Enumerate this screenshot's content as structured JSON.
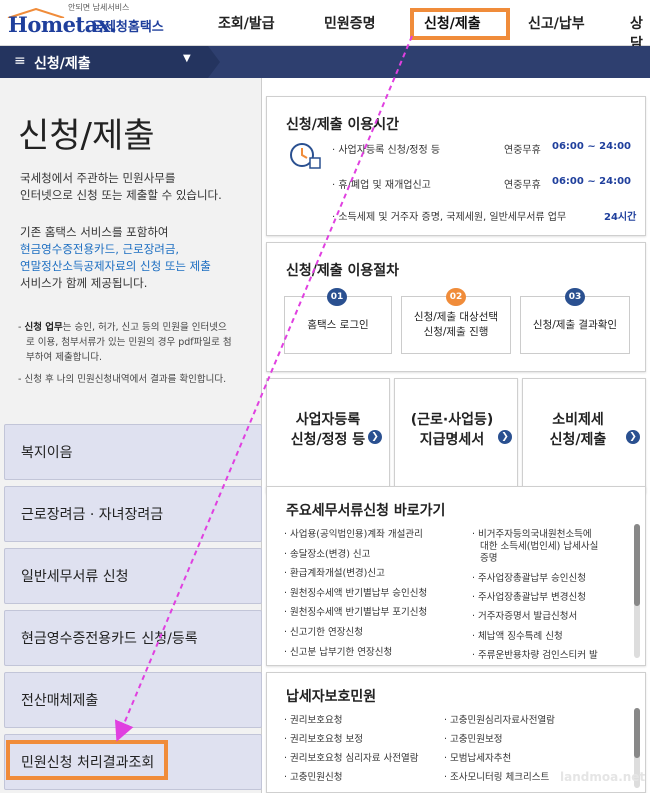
{
  "logo": {
    "slogan": "안되면 남세서비스",
    "main": "Hometax.",
    "sub": "국세청홈택스"
  },
  "nav": {
    "items": [
      "조회/발급",
      "민원증명",
      "신청/제출",
      "신고/납부",
      "상담"
    ]
  },
  "band": {
    "title": "신청/제출"
  },
  "left": {
    "title": "신청/제출",
    "desc1": [
      "국세청에서 주관하는 민원사무를",
      "인터넷으로 신청 또는 제출할 수 있습니다."
    ],
    "desc2_plain": "기존 홈택스 서비스를 포함하여",
    "desc2_links": [
      "현금영수증전용카드, 근로장려금,",
      "연말정산소득공제자료의 신청 또는 제출"
    ],
    "desc2_tail": "서비스가 함께 제공됩니다.",
    "note1_bold": "신청 업무",
    "note1": "는 승인, 허가, 신고 등의 민원을 인터넷으",
    "note1b": "로 이용, 첨부서류가 있는 민원의 경우 pdf파일로 첨",
    "note1c": "부하여 제출합니다.",
    "note2": "신청 후 나의 민원신청내역에서 결과를 확인합니다.",
    "menu": [
      "복지이음",
      "근로장려금 · 자녀장려금",
      "일반세무서류 신청",
      "현금영수증전용카드 신청/등록",
      "전산매체제출",
      "민원신청 처리결과조회"
    ]
  },
  "hours": {
    "title": "신청/제출 이용시간",
    "rows": [
      {
        "label": "사업자등록 신청/정정 등",
        "kind": "연중무휴",
        "time": "06:00 ~ 24:00"
      },
      {
        "label": "휴/폐업 및 재개업신고",
        "kind": "연중무휴",
        "time": "06:00 ~ 24:00"
      },
      {
        "label": "소득세제 및 거주자 증명, 국제세원, 일반세무서류 업무",
        "kind": "",
        "time": "24시간"
      }
    ]
  },
  "procedure": {
    "title": "신청/제출 이용절차",
    "steps": [
      {
        "num": "01",
        "line1": "홈택스 로그인",
        "line2": ""
      },
      {
        "num": "02",
        "line1": "신청/제출 대상선택",
        "line2": "신청/제출 진행"
      },
      {
        "num": "03",
        "line1": "신청/제출 결과확인",
        "line2": ""
      }
    ]
  },
  "tiles": [
    {
      "line1": "사업자등록",
      "line2": "신청/정정 등"
    },
    {
      "line1": "(근로·사업등)",
      "line2": "지급명세서"
    },
    {
      "line1": "소비제세",
      "line2": "신청/제출"
    }
  ],
  "shortcuts": {
    "title": "주요세무서류신청 바로가기",
    "left": [
      "사업용(공익법인용)계좌 개설관리",
      "송달장소(변경) 신고",
      "환급계좌개설(변경)신고",
      "원천징수세액 반기별납부 승인신청",
      "원천징수세액 반기별납부 포기신청",
      "신고기한 연장신청",
      "신고분 납부기한 연장신청"
    ],
    "right": [
      "비거주자등의국내원천소득에",
      "대한 소득세(법인세) 납세사실",
      "증명",
      "주사업장총괄납부 승인신청",
      "주사업장총괄납부 변경신청",
      "거주자증명서 발급신청서",
      "체납액 징수특례 신청",
      "주류운반용차량 검인스티커 발"
    ]
  },
  "protect": {
    "title": "납세자보호민원",
    "left": [
      "권리보호요청",
      "권리보호요청 보정",
      "권리보호요청 심리자료 사전열람",
      "고충민원신청"
    ],
    "right": [
      "고충민원심리자료사전열람",
      "고충민원보정",
      "모범납세자추천",
      "조사모니터링 체크리스트"
    ]
  },
  "watermark": "landmoa.net",
  "colors": {
    "accent": "#f08c3a",
    "brand": "#1f3f9c",
    "band": "#2e3f6f",
    "arrow": "#e040e0"
  }
}
